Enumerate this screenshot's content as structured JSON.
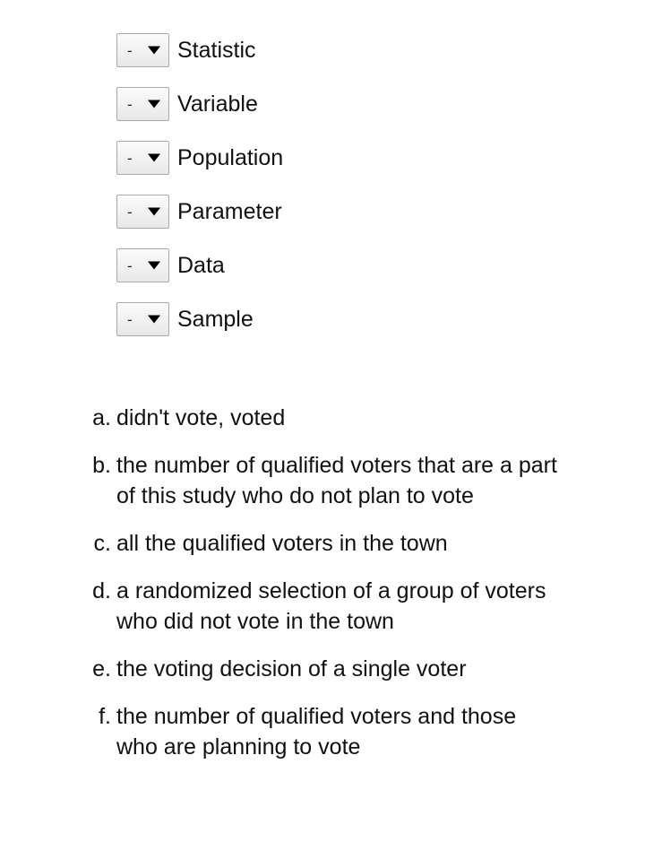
{
  "matching": {
    "placeholder_value": "-",
    "dropdown_arrow_icon": "chevron-down-icon",
    "rows": [
      {
        "label": "Statistic",
        "value": "-"
      },
      {
        "label": "Variable",
        "value": "-"
      },
      {
        "label": "Population",
        "value": "-"
      },
      {
        "label": "Parameter",
        "value": "-"
      },
      {
        "label": "Data",
        "value": "-"
      },
      {
        "label": "Sample",
        "value": "-"
      }
    ]
  },
  "options": [
    {
      "marker": "a.",
      "text": "didn't vote, voted"
    },
    {
      "marker": "b.",
      "text": "the number of qualified voters that are a part of this study who do not plan to vote"
    },
    {
      "marker": "c.",
      "text": "all the qualified voters in the town"
    },
    {
      "marker": "d.",
      "text": "a randomized selection of a group of voters who did not vote in the town"
    },
    {
      "marker": "e.",
      "text": "the voting decision of a single voter"
    },
    {
      "marker": "f.",
      "text": "the number of qualified voters and those who are planning to vote"
    }
  ],
  "colors": {
    "page_background": "#ffffff",
    "text": "#111111",
    "select_border": "#a9a9a9",
    "select_background": "#f3f3f3",
    "select_arrow": "#000000"
  }
}
